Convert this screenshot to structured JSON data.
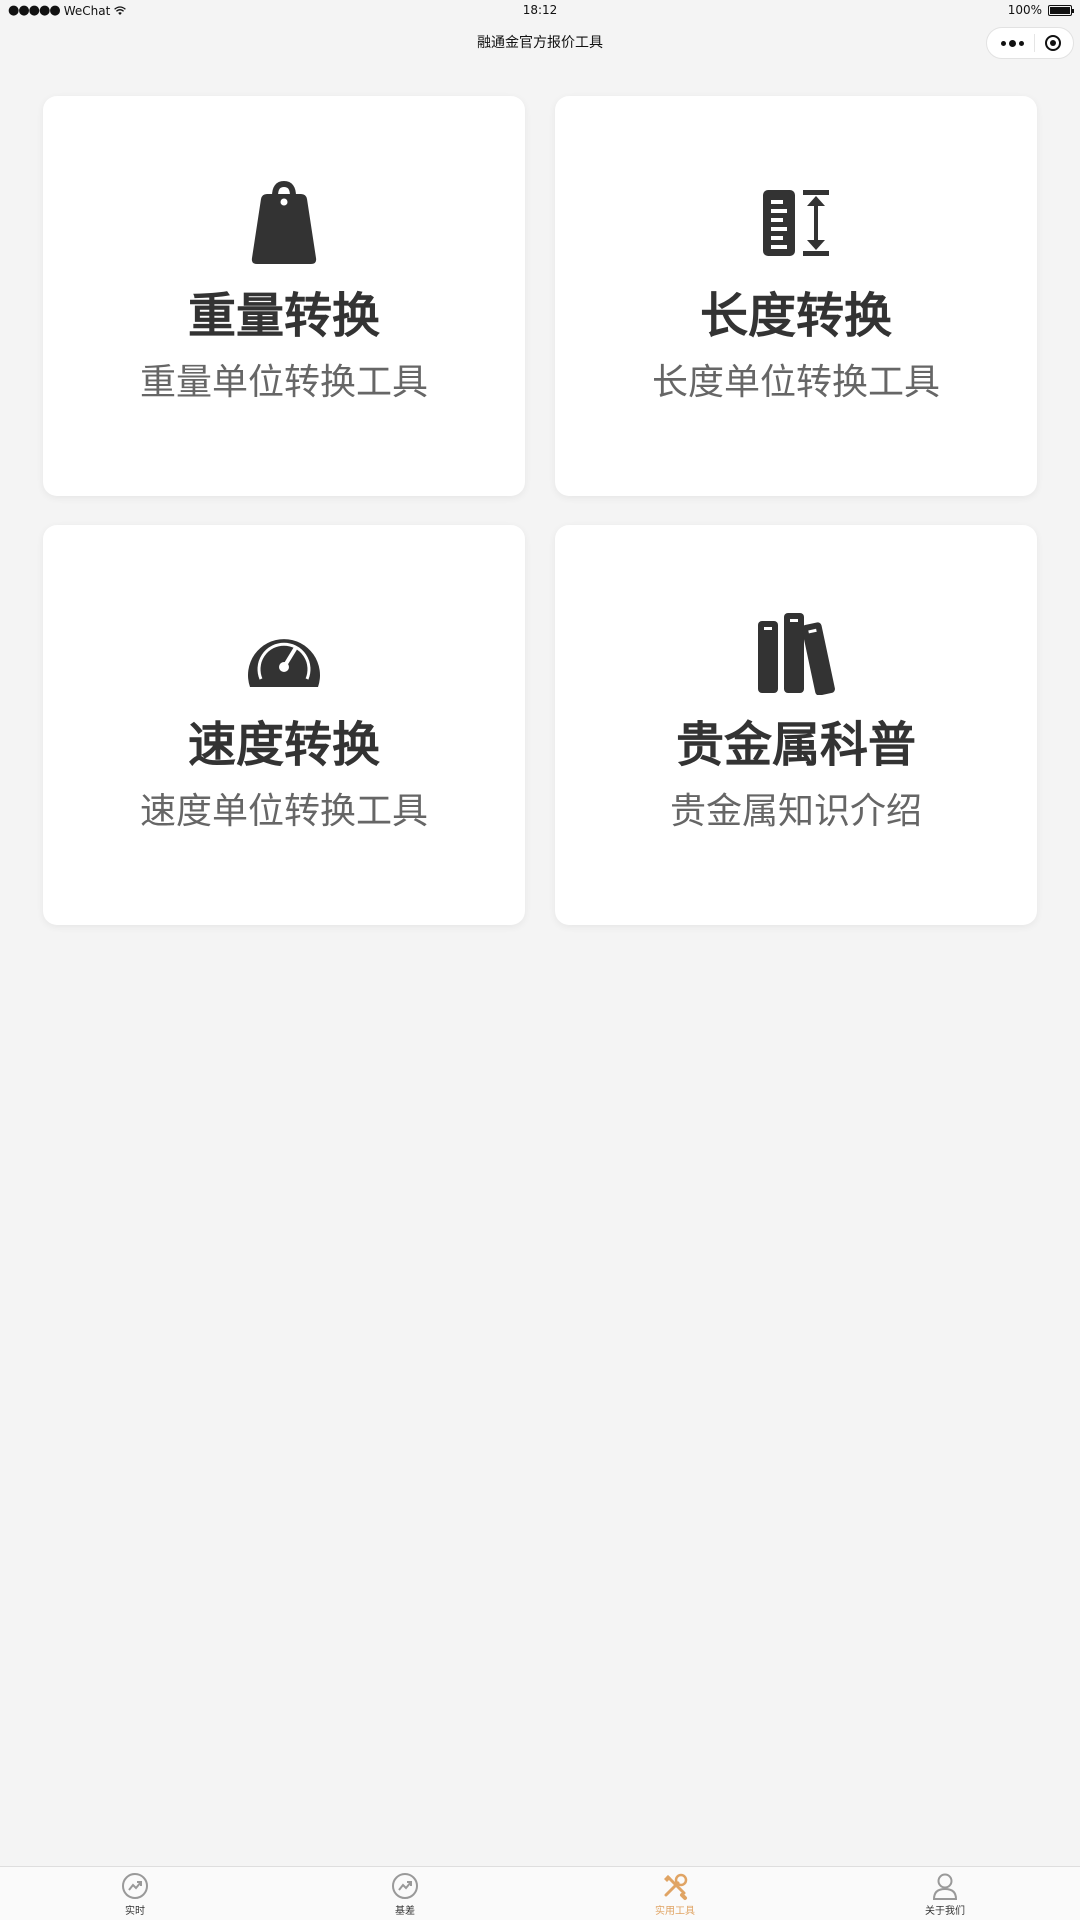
{
  "status_bar": {
    "carrier": "WeChat",
    "time": "18:12",
    "battery": "100%"
  },
  "nav": {
    "title": "融通金官方报价工具"
  },
  "cards": [
    {
      "title": "重量转换",
      "subtitle": "重量单位转换工具",
      "icon": "weight-icon"
    },
    {
      "title": "长度转换",
      "subtitle": "长度单位转换工具",
      "icon": "ruler-icon"
    },
    {
      "title": "速度转换",
      "subtitle": "速度单位转换工具",
      "icon": "speedometer-icon"
    },
    {
      "title": "贵金属科普",
      "subtitle": "贵金属知识介绍",
      "icon": "books-icon"
    }
  ],
  "tabs": [
    {
      "label": "实时",
      "icon": "trend-icon",
      "active": false
    },
    {
      "label": "基差",
      "icon": "trend-icon",
      "active": false
    },
    {
      "label": "实用工具",
      "icon": "tools-icon",
      "active": true
    },
    {
      "label": "关于我们",
      "icon": "user-icon",
      "active": false
    }
  ],
  "colors": {
    "background": "#f4f4f4",
    "card": "#ffffff",
    "icon": "#333333",
    "active_tab": "#e0a464",
    "inactive_tab_icon": "#999999"
  }
}
